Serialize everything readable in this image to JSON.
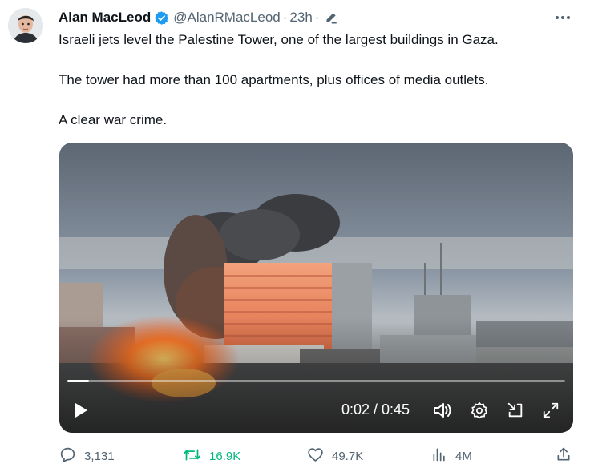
{
  "tweet": {
    "author_name": "Alan MacLeod",
    "handle": "@AlanRMacLeod",
    "separator": "·",
    "time": "23h",
    "paragraphs": [
      "Israeli jets level the Palestine Tower, one of the largest buildings in Gaza.",
      "The tower had more than 100 apartments, plus offices of media outlets.",
      "A clear war crime."
    ]
  },
  "video": {
    "current_time": "0:02",
    "duration": "0:45",
    "time_display": "0:02 / 0:45",
    "progress_fraction": 0.044
  },
  "metrics": {
    "replies": "3,131",
    "reposts": "16.9K",
    "likes": "49.7K",
    "views": "4M"
  },
  "colors": {
    "verified": "#1d9bf0",
    "repost_active": "#00ba7c",
    "secondary_text": "#536471"
  },
  "icons": [
    "verified-badge-icon",
    "edit-pencil-icon",
    "more-icon",
    "play-icon",
    "volume-icon",
    "settings-icon",
    "minimize-icon",
    "fullscreen-icon",
    "reply-icon",
    "repost-icon",
    "like-icon",
    "views-icon",
    "share-icon"
  ]
}
